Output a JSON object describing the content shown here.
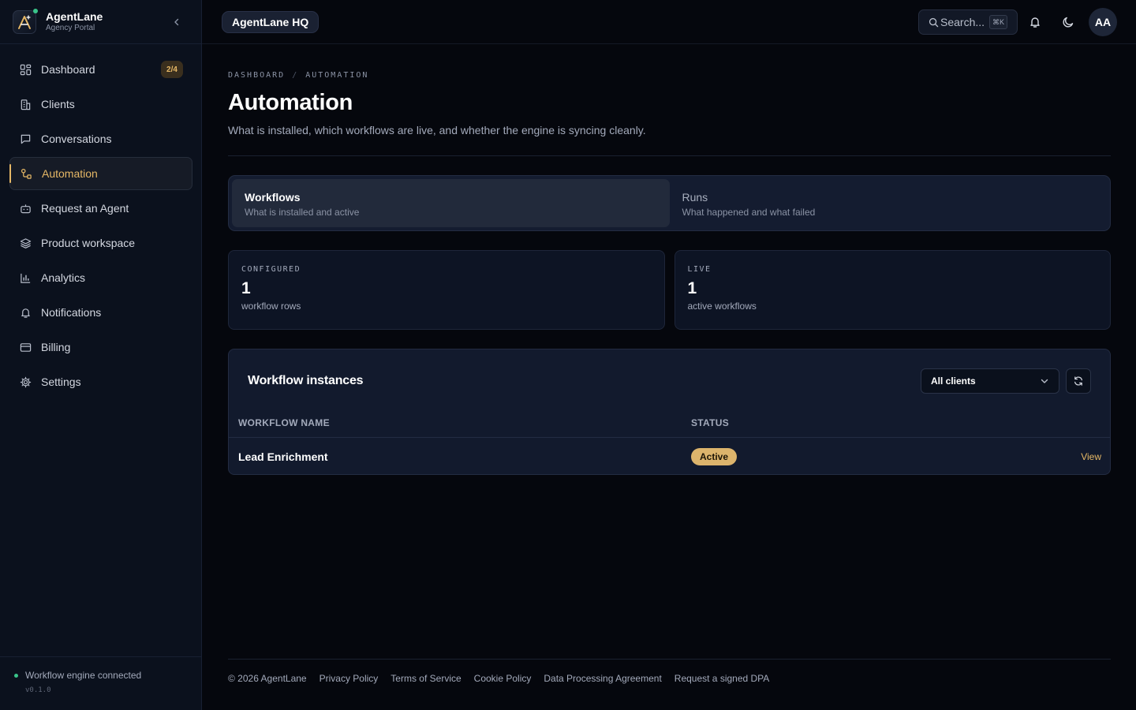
{
  "brand": {
    "name": "AgentLane",
    "subtitle": "Agency Portal"
  },
  "sidebar": {
    "items": [
      {
        "label": "Dashboard",
        "icon": "dashboard-icon",
        "badge": "2/4"
      },
      {
        "label": "Clients",
        "icon": "building-icon"
      },
      {
        "label": "Conversations",
        "icon": "chat-icon"
      },
      {
        "label": "Automation",
        "icon": "workflow-icon",
        "active": true
      },
      {
        "label": "Request an Agent",
        "icon": "bot-icon"
      },
      {
        "label": "Product workspace",
        "icon": "layers-icon"
      },
      {
        "label": "Analytics",
        "icon": "bar-chart-icon"
      },
      {
        "label": "Notifications",
        "icon": "bell-icon"
      },
      {
        "label": "Billing",
        "icon": "credit-card-icon"
      },
      {
        "label": "Settings",
        "icon": "gear-icon"
      }
    ],
    "footer": {
      "status": "Workflow engine connected",
      "version": "v0.1.0"
    }
  },
  "topbar": {
    "workspace": "AgentLane HQ",
    "search": {
      "placeholder": "Search...",
      "shortcut": "⌘K"
    },
    "avatar": "AA"
  },
  "breadcrumb": [
    "DASHBOARD",
    "AUTOMATION"
  ],
  "page": {
    "title": "Automation",
    "description": "What is installed, which workflows are live, and whether the engine is syncing cleanly."
  },
  "tabs": [
    {
      "title": "Workflows",
      "subtitle": "What is installed and active",
      "active": true
    },
    {
      "title": "Runs",
      "subtitle": "What happened and what failed",
      "active": false
    }
  ],
  "stats": [
    {
      "label": "CONFIGURED",
      "value": "1",
      "sub": "workflow rows"
    },
    {
      "label": "LIVE",
      "value": "1",
      "sub": "active workflows"
    }
  ],
  "panel": {
    "title": "Workflow instances",
    "filter": "All clients",
    "columns": [
      "WORKFLOW NAME",
      "STATUS"
    ],
    "rows": [
      {
        "name": "Lead Enrichment",
        "status": "Active",
        "action": "View"
      }
    ]
  },
  "footer": {
    "copyright": "© 2026 AgentLane",
    "links": [
      "Privacy Policy",
      "Terms of Service",
      "Cookie Policy",
      "Data Processing Agreement",
      "Request a signed DPA"
    ]
  },
  "colors": {
    "accent": "#e6b866",
    "success": "#3ac48a",
    "background": "#05070d",
    "sidebar": "#0b111d"
  }
}
